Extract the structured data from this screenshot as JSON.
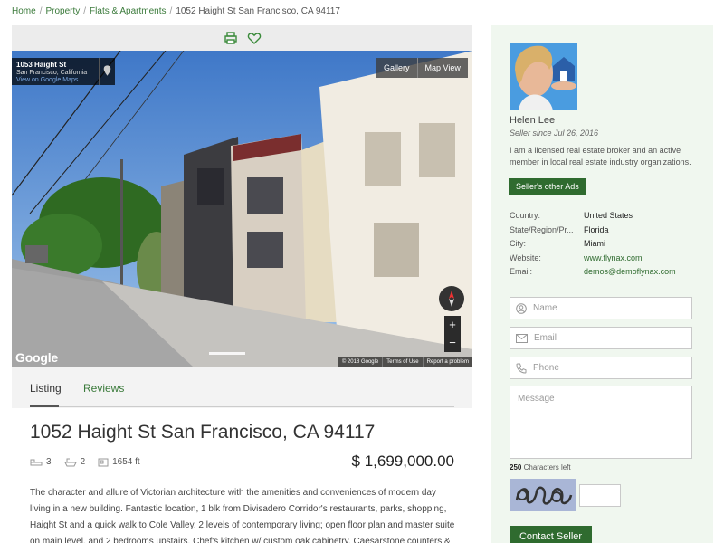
{
  "breadcrumb": {
    "home": "Home",
    "property": "Property",
    "category": "Flats & Apartments",
    "current": "1052 Haight St San Francisco, CA 94117"
  },
  "toolbar": {
    "print_icon": "print-icon",
    "favorite_icon": "heart-icon"
  },
  "streetview": {
    "address": "1053 Haight St",
    "city": "San Francisco, California",
    "link": "View on Google Maps",
    "gallery_label": "Gallery",
    "mapview_label": "Map View",
    "google_logo": "Google",
    "copyright": "© 2018 Google",
    "terms": "Terms of Use",
    "report": "Report a problem",
    "zoom_in": "+",
    "zoom_out": "−"
  },
  "tabs": {
    "listing": "Listing",
    "reviews": "Reviews"
  },
  "listing": {
    "title": "1052 Haight St San Francisco, CA 94117",
    "bedrooms": "3",
    "bathrooms": "2",
    "area": "1654 ft",
    "price": "$ 1,699,000.00",
    "description": "The character and allure of Victorian architecture with the amenities and conveniences of modern day living in a new building. Fantastic location, 1 blk from Divisadero Corridor's restaurants, parks, shopping, Haight St and a quick walk to Cole Valley. 2 levels of contemporary living; open floor plan and master suite on main level, and 2 bedrooms upstairs. Chef's kitchen w/ custom oak cabinetry, Caesarstone counters & island, and Viking,"
  },
  "seller": {
    "name": "Helen Lee",
    "since": "Seller since Jul 26, 2016",
    "bio": "I am a licensed real estate broker and an active member in local real estate industry organizations.",
    "other_ads_label": "Seller's other Ads",
    "info": [
      {
        "key": "Country:",
        "value": "United States"
      },
      {
        "key": "State/Region/Pr...",
        "value": "Florida"
      },
      {
        "key": "City:",
        "value": "Miami"
      },
      {
        "key": "Website:",
        "value": "www.flynax.com"
      },
      {
        "key": "Email:",
        "value": "demos@demoflynax.com"
      }
    ]
  },
  "contact_form": {
    "name_placeholder": "Name",
    "email_placeholder": "Email",
    "phone_placeholder": "Phone",
    "message_placeholder": "Message",
    "chars_count": "250",
    "chars_label": "Characters left",
    "submit_label": "Contact Seller"
  },
  "colors": {
    "accent": "#2f6b2f",
    "link": "#3a7a3a",
    "sidebar_bg": "#f0f7ef"
  }
}
